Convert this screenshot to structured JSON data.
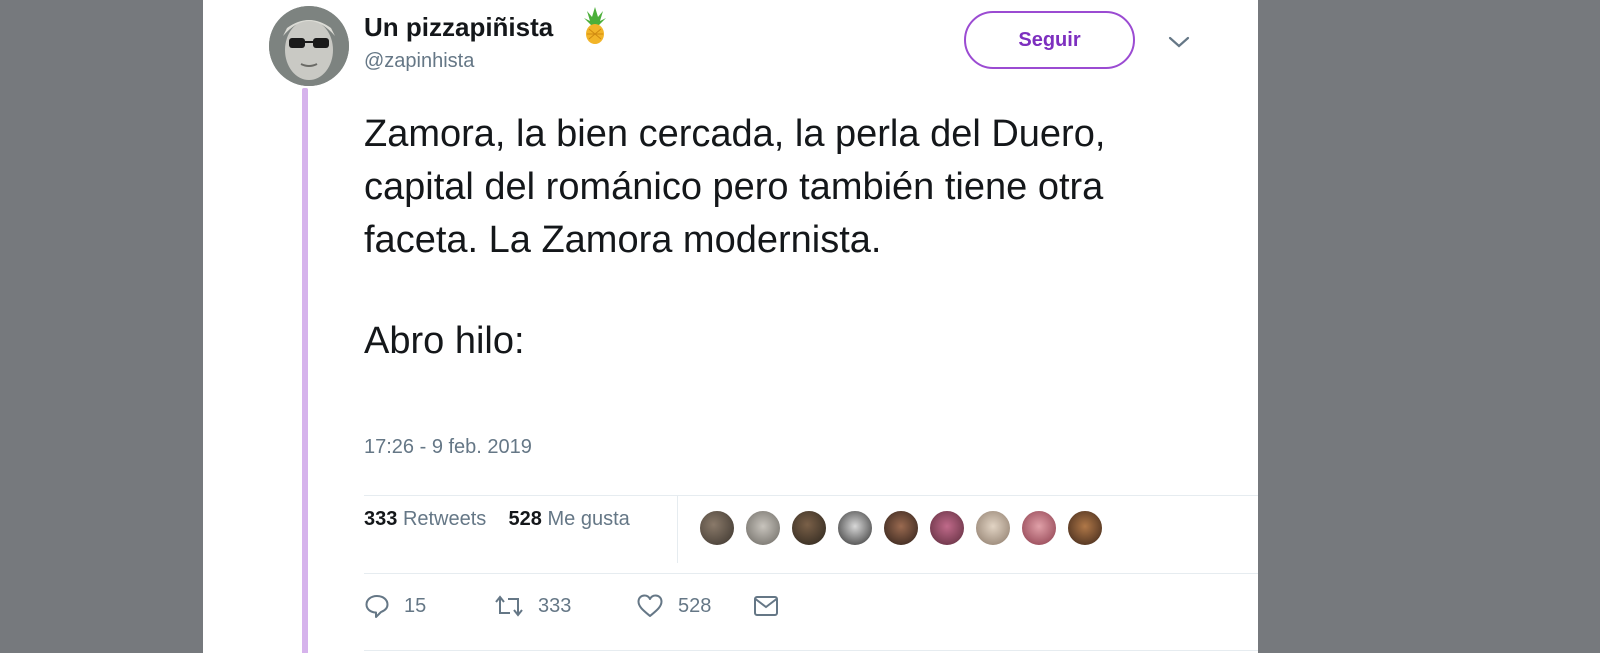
{
  "author": {
    "name": "Un pizzapiñista",
    "handle": "@zapinhista",
    "emoji_icon": "pineapple-icon"
  },
  "follow_button": {
    "label": "Seguir"
  },
  "tweet": {
    "paragraph_1": "Zamora, la bien cercada, la perla del Duero, capital del románico pero también tiene otra faceta. La Zamora modernista.",
    "paragraph_2": "Abro hilo:",
    "timestamp": "17:26 - 9 feb. 2019"
  },
  "stats": {
    "retweets_count": "333",
    "retweets_label": "Retweets",
    "likes_count": "528",
    "likes_label": "Me gusta"
  },
  "likers_count_shown": 9,
  "actions": {
    "reply_count": "15",
    "retweet_count": "333",
    "like_count": "528"
  },
  "colors": {
    "accent": "#9b4bd2",
    "thread_line": "#d6b3ec",
    "text": "#14171a",
    "muted": "#657786",
    "backdrop": "#76797d"
  }
}
